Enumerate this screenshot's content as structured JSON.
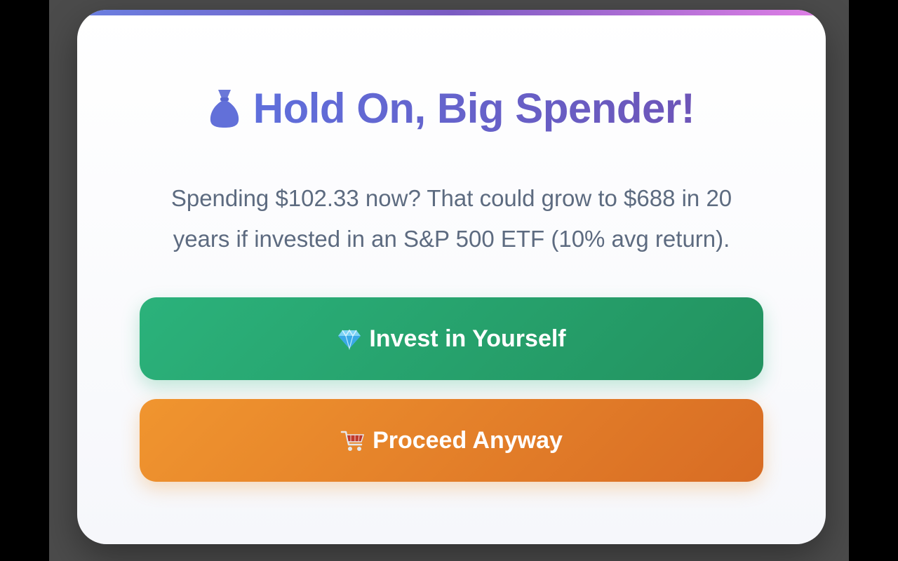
{
  "dialog": {
    "title_icon": "money-bag-icon",
    "title": "Hold On, Big Spender!",
    "message": "Spending $102.33 now? That could grow to $688 in 20 years if invested in an S&P 500 ETF (10% avg return).",
    "accent_gradient": [
      "#6a7fe0",
      "#7a5bc2",
      "#e07fe6"
    ],
    "title_color": "#5f6fdc"
  },
  "buttons": {
    "invest": {
      "icon": "diamond-icon",
      "label": "Invest in Yourself",
      "color": "#2bb27b"
    },
    "proceed": {
      "icon": "shopping-cart-icon",
      "label": "Proceed Anyway",
      "color": "#f0952f"
    }
  }
}
